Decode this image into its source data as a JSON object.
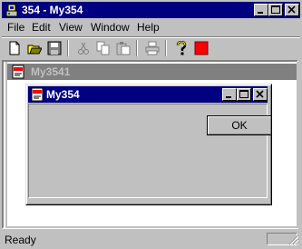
{
  "window": {
    "title": "354 - My354"
  },
  "menu": {
    "items": [
      "File",
      "Edit",
      "View",
      "Window",
      "Help"
    ]
  },
  "toolbar": {
    "icons": [
      "new-icon",
      "open-icon",
      "save-icon",
      "cut-icon",
      "copy-icon",
      "paste-icon",
      "print-icon",
      "help-icon",
      "stop-icon"
    ],
    "accent_red": "#ff0000"
  },
  "child_window": {
    "title": "My3541"
  },
  "dialog": {
    "title": "My354",
    "ok_label": "OK"
  },
  "status": {
    "text": "Ready"
  },
  "colors": {
    "active_title": "#000080",
    "inactive_title": "#808080",
    "face": "#c0c0c0"
  }
}
